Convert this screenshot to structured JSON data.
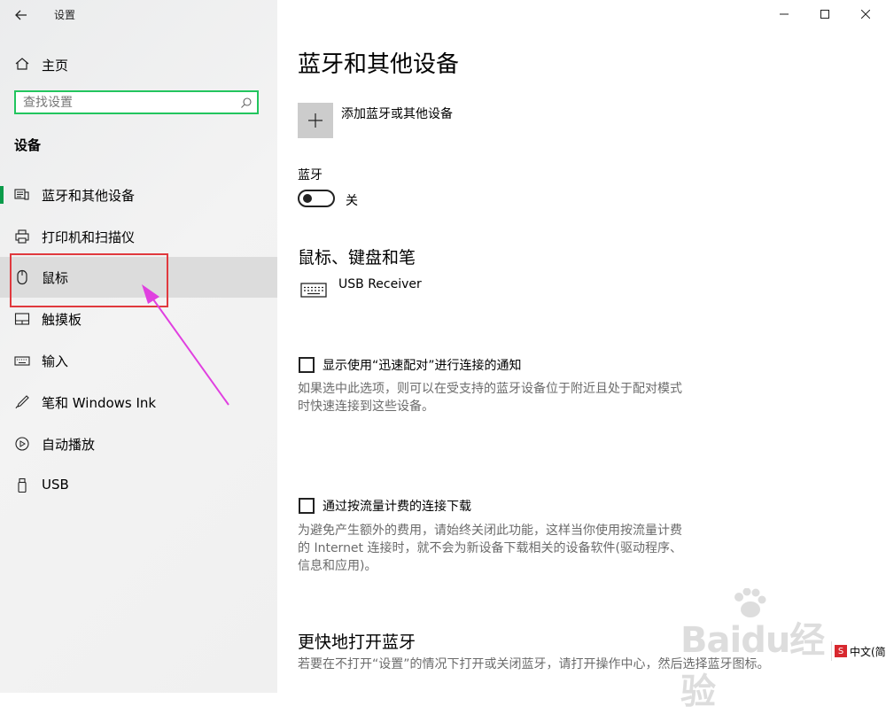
{
  "window": {
    "title": "设置"
  },
  "sidebar": {
    "home_label": "主页",
    "search": {
      "placeholder": "查找设置",
      "value": ""
    },
    "section_title": "设备",
    "items": [
      {
        "label": "蓝牙和其他设备",
        "icon": "bluetooth-devices-icon",
        "active": true
      },
      {
        "label": "打印机和扫描仪",
        "icon": "printer-icon"
      },
      {
        "label": "鼠标",
        "icon": "mouse-icon",
        "hovered": true
      },
      {
        "label": "触摸板",
        "icon": "touchpad-icon"
      },
      {
        "label": "输入",
        "icon": "keyboard-icon"
      },
      {
        "label": "笔和 Windows Ink",
        "icon": "pen-icon"
      },
      {
        "label": "自动播放",
        "icon": "autoplay-icon"
      },
      {
        "label": "USB",
        "icon": "usb-icon"
      }
    ]
  },
  "main": {
    "title": "蓝牙和其他设备",
    "add_device_label": "添加蓝牙或其他设备",
    "bluetooth": {
      "label": "蓝牙",
      "state_label": "关",
      "on": false
    },
    "mouse_section": {
      "title": "鼠标、键盘和笔",
      "devices": [
        {
          "name": "USB Receiver",
          "icon": "keyboard-icon"
        }
      ]
    },
    "swift_pair": {
      "label": "显示使用“迅速配对”进行连接的通知",
      "checked": false,
      "description": "如果选中此选项，则可以在受支持的蓝牙设备位于附近且处于配对模式时快速连接到这些设备。"
    },
    "metered": {
      "label": "通过按流量计费的连接下载",
      "checked": false,
      "description": "为避免产生额外的费用，请始终关闭此功能，这样当你使用按流量计费的 Internet 连接时，就不会为新设备下载相关的设备软件(驱动程序、信息和应用)。"
    },
    "quick_bt": {
      "title": "更快地打开蓝牙",
      "description": "若要在不打开“设置”的情况下打开或关闭蓝牙，请打开操作中心，然后选择蓝牙图标。"
    }
  },
  "watermark": {
    "text": "Baidu经验"
  },
  "ime": {
    "label": "中文(简"
  },
  "colors": {
    "accent": "#0a9b4a",
    "search_border": "#22c55e",
    "highlight": "#e0393e",
    "arrow": "#e040e0"
  }
}
